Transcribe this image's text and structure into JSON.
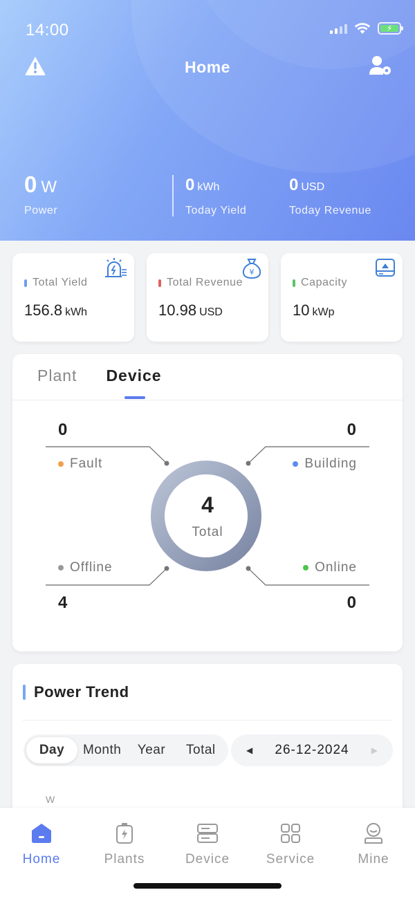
{
  "status_bar": {
    "time": "14:00"
  },
  "header": {
    "title": "Home",
    "power": {
      "value": "0",
      "unit": "W",
      "label": "Power"
    },
    "today_yield": {
      "value": "0",
      "unit": "kWh",
      "label": "Today Yield"
    },
    "today_revenue": {
      "value": "0",
      "unit": "USD",
      "label": "Today Revenue"
    },
    "icons": {
      "left": "alert-triangle-icon",
      "right": "user-settings-icon"
    }
  },
  "summary": [
    {
      "label": "Total Yield",
      "value": "156.8",
      "unit": "kWh",
      "color": "#6f9df0",
      "icon": "solar-alarm-icon"
    },
    {
      "label": "Total Revenue",
      "value": "10.98",
      "unit": "USD",
      "color": "#e06060",
      "icon": "money-bag-icon"
    },
    {
      "label": "Capacity",
      "value": "10",
      "unit": "kWp",
      "color": "#5cc46a",
      "icon": "capacity-box-icon"
    }
  ],
  "device_panel": {
    "tabs": [
      "Plant",
      "Device"
    ],
    "active_tab": "Device",
    "total": {
      "value": "4",
      "label": "Total"
    },
    "fault": {
      "label": "Fault",
      "value": "0",
      "color": "#f0a050"
    },
    "building": {
      "label": "Building",
      "value": "0",
      "color": "#5b8cf0"
    },
    "offline": {
      "label": "Offline",
      "value": "4",
      "color": "#999999"
    },
    "online": {
      "label": "Online",
      "value": "0",
      "color": "#4cc44c"
    }
  },
  "power_trend": {
    "title": "Power Trend",
    "periods": [
      "Day",
      "Month",
      "Year",
      "Total"
    ],
    "selected_period": "Day",
    "date": "26-12-2024",
    "y_unit": "W"
  },
  "bottom_nav": [
    {
      "label": "Home",
      "icon": "home-icon",
      "active": true
    },
    {
      "label": "Plants",
      "icon": "plants-icon",
      "active": false
    },
    {
      "label": "Device",
      "icon": "device-icon",
      "active": false
    },
    {
      "label": "Service",
      "icon": "service-grid-icon",
      "active": false
    },
    {
      "label": "Mine",
      "icon": "profile-icon",
      "active": false
    }
  ],
  "colors": {
    "accent": "#5b7bee",
    "header_start": "#a9cdfb",
    "header_end": "#6a88f0"
  }
}
